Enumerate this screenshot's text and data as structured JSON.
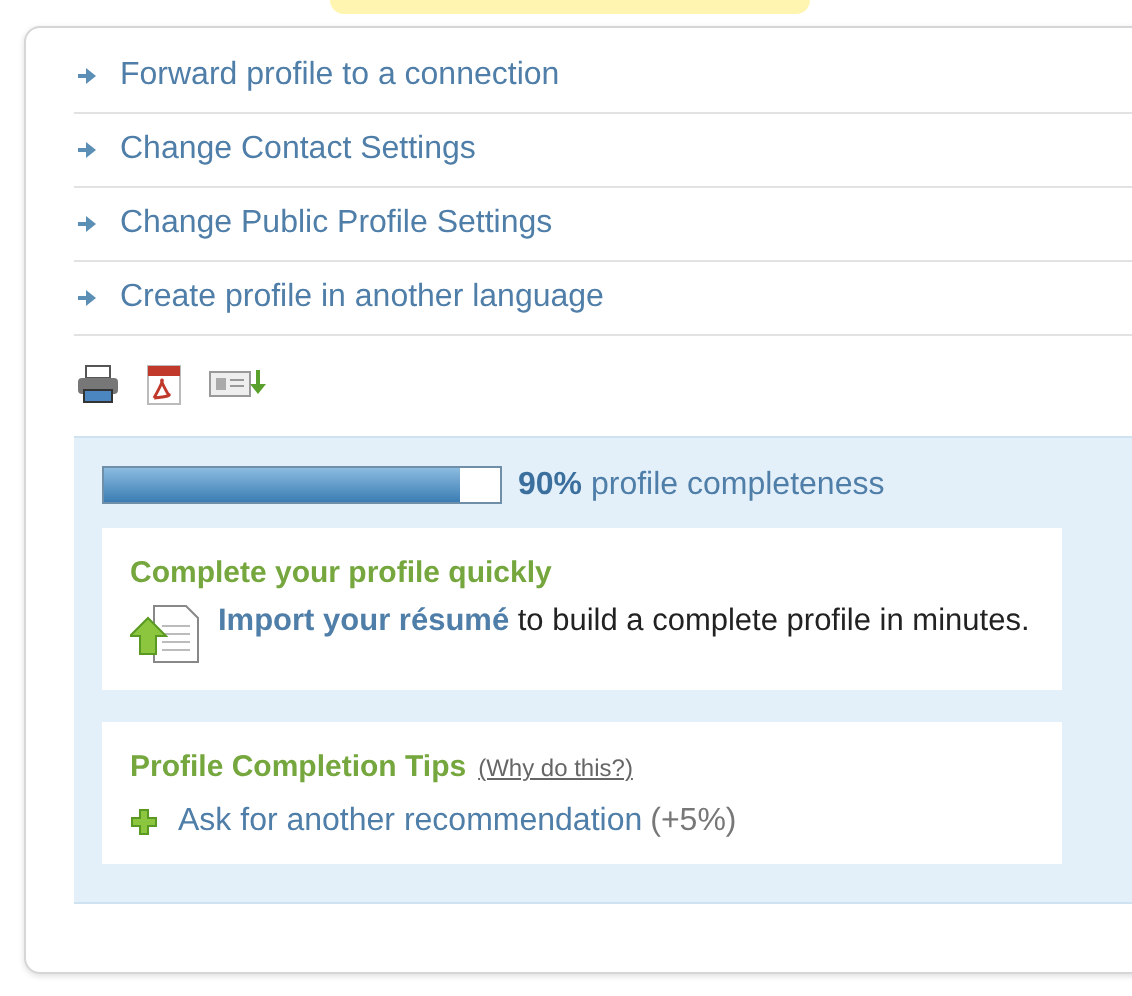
{
  "links": [
    "Forward profile to a connection",
    "Change Contact Settings",
    "Change Public Profile Settings",
    "Create profile in another language"
  ],
  "completeness": {
    "level": 0.9,
    "label": "**90%** profile completeness"
  },
  "quick": {
    "title": "Complete your profile quickly",
    "link": "Import your résumé",
    "text": "to build a complete profile in minutes."
  },
  "tips": {
    "title": "Profile Completion Tips",
    "why": "(Why do this?)",
    "items": [
      {
        "link": "Ask for another recommendation",
        "bonus": "(+5%)"
      }
    ]
  }
}
